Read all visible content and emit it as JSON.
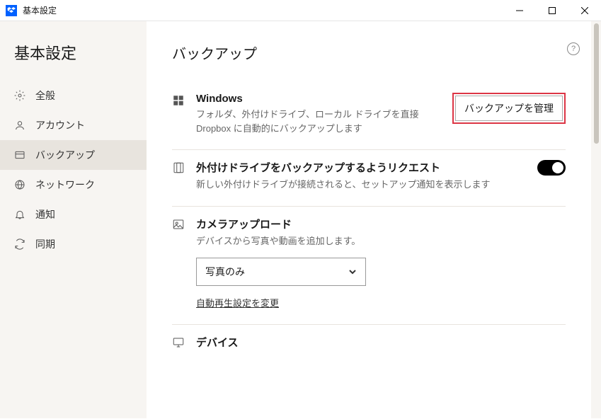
{
  "titlebar": {
    "title": "基本設定"
  },
  "page": {
    "title": "基本設定"
  },
  "sidebar": {
    "items": [
      {
        "label": "全般"
      },
      {
        "label": "アカウント"
      },
      {
        "label": "バックアップ"
      },
      {
        "label": "ネットワーク"
      },
      {
        "label": "通知"
      },
      {
        "label": "同期"
      }
    ]
  },
  "content": {
    "title": "バックアップ",
    "windows": {
      "heading": "Windows",
      "desc": "フォルダ、外付けドライブ、ローカル ドライブを直接 Dropbox に自動的にバックアップします",
      "button": "バックアップを管理"
    },
    "external": {
      "heading": "外付けドライブをバックアップするようリクエスト",
      "desc": "新しい外付けドライブが接続されると、セットアップ通知を表示します",
      "toggle": true
    },
    "camera": {
      "heading": "カメラアップロード",
      "desc": "デバイスから写真や動画を追加します。",
      "select_value": "写真のみ",
      "link": "自動再生設定を変更"
    },
    "device": {
      "heading": "デバイス"
    }
  }
}
